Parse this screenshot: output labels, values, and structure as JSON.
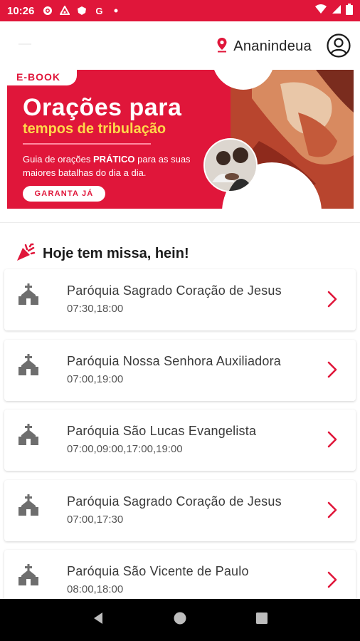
{
  "status_bar": {
    "time": "10:26",
    "icons": [
      "gear-icon",
      "mail-icon",
      "shield-icon",
      "google-icon",
      "dot-icon"
    ],
    "right_icons": [
      "wifi-icon",
      "signal-icon",
      "battery-icon"
    ],
    "google_letter": "G"
  },
  "header": {
    "location": "Ananindeua"
  },
  "banner": {
    "tag": "E-BOOK",
    "title": "Orações para",
    "subtitle": "tempos de tribulação",
    "desc_pre": "Guia de orações ",
    "desc_bold": "PRÁTICO",
    "desc_post": " para as suas maiores batalhas do dia a dia.",
    "cta": "GARANTA JÁ"
  },
  "section": {
    "title": "Hoje tem missa, hein!"
  },
  "parishes": [
    {
      "name": "Paróquia Sagrado Coração de Jesus",
      "times": "07:30,18:00"
    },
    {
      "name": "Paróquia Nossa Senhora Auxiliadora",
      "times": "07:00,19:00"
    },
    {
      "name": "Paróquia São Lucas Evangelista",
      "times": "07:00,09:00,17:00,19:00"
    },
    {
      "name": "Paróquia Sagrado Coração de Jesus",
      "times": "07:00,17:30"
    },
    {
      "name": "Paróquia São Vicente de Paulo",
      "times": "08:00,18:00"
    }
  ],
  "colors": {
    "accent": "#e0163a",
    "highlight": "#ffd84a"
  }
}
